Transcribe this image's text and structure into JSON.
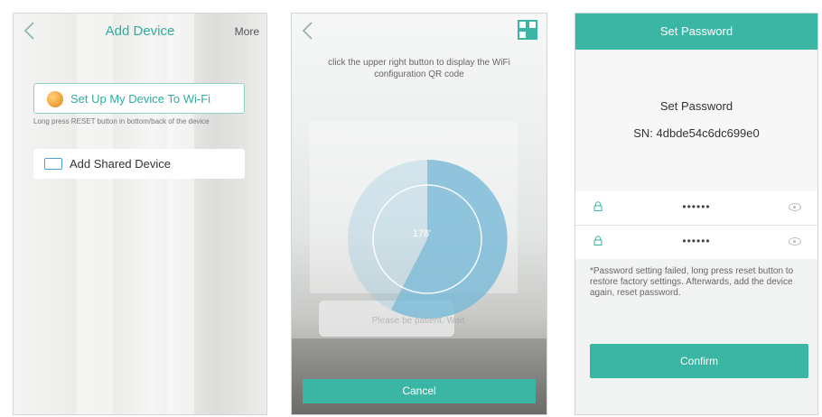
{
  "screen1": {
    "nav": {
      "title": "Add Device",
      "more": "More"
    },
    "setup_wifi": {
      "label": "Set Up My Device To Wi-Fi",
      "hint": "Long press RESET button in bottom/back of the device"
    },
    "shared_device": {
      "label": "Add Shared Device"
    },
    "icons": {
      "back": "chevron-left-icon",
      "wifi": "device-orb-icon",
      "shared": "keyboard-icon"
    }
  },
  "screen2": {
    "instruction": "click the upper right button to display the WiFi configuration QR code",
    "gauge_value": "178'",
    "waiting_text": "Please be patient. Wait",
    "cancel": "Cancel",
    "icons": {
      "back": "chevron-left-icon",
      "qr": "qr-code-icon"
    }
  },
  "screen3": {
    "header_title": "Set Password",
    "heading": "Set Password",
    "sn": "SN: 4dbde54c6dc699e0",
    "password1": "••••••",
    "password2": "••••••",
    "note": "*Password setting failed, long press reset button to restore factory settings. Afterwards, add the device again, reset password.",
    "confirm": "Confirm"
  },
  "colors": {
    "accent": "#3bb5a4",
    "accent_text": "#2fae9f"
  }
}
